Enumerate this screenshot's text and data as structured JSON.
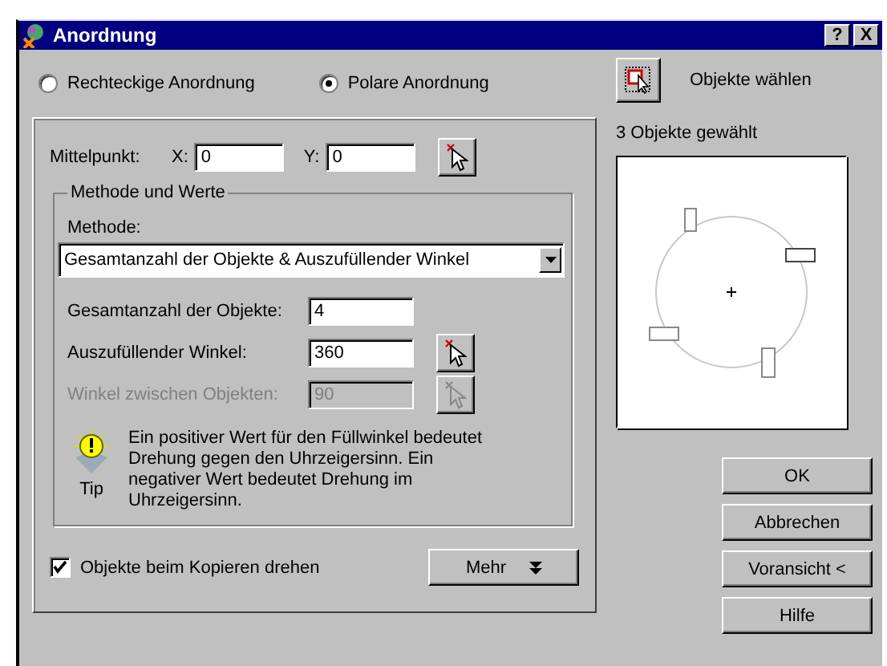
{
  "window": {
    "title": "Anordnung",
    "help_button": "?",
    "close_button": "X"
  },
  "arrangement_types": [
    {
      "label": "Rechteckige Anordnung",
      "selected": false
    },
    {
      "label": "Polare Anordnung",
      "selected": true
    }
  ],
  "center": {
    "label": "Mittelpunkt:",
    "x_label": "X:",
    "x_value": "0",
    "y_label": "Y:",
    "y_value": "0"
  },
  "method_group": {
    "title": "Methode und Werte",
    "method_label": "Methode:",
    "method_value": "Gesamtanzahl der Objekte & Auszufüllender Winkel",
    "fields": [
      {
        "label": "Gesamtanzahl der Objekte:",
        "value": "4",
        "disabled": false,
        "pick_button": false
      },
      {
        "label": "Auszufüllender Winkel:",
        "value": "360",
        "disabled": false,
        "pick_button": true
      },
      {
        "label": "Winkel zwischen Objekten:",
        "value": "90",
        "disabled": true,
        "pick_button": true
      }
    ],
    "tip": {
      "label": "Tip",
      "text": "Ein positiver Wert für den Füllwinkel bedeutet Drehung gegen den Uhrzeigersinn. Ein negativer Wert bedeutet Drehung im Uhrzeigersinn."
    }
  },
  "rotate_checkbox": {
    "label": "Objekte beim Kopieren drehen",
    "checked": true
  },
  "more_button": {
    "label": "Mehr"
  },
  "select_objects": {
    "label": "Objekte wählen",
    "status": "3 Objekte gewählt"
  },
  "buttons": [
    "OK",
    "Abbrechen",
    "Voransicht <",
    "Hilfe"
  ]
}
